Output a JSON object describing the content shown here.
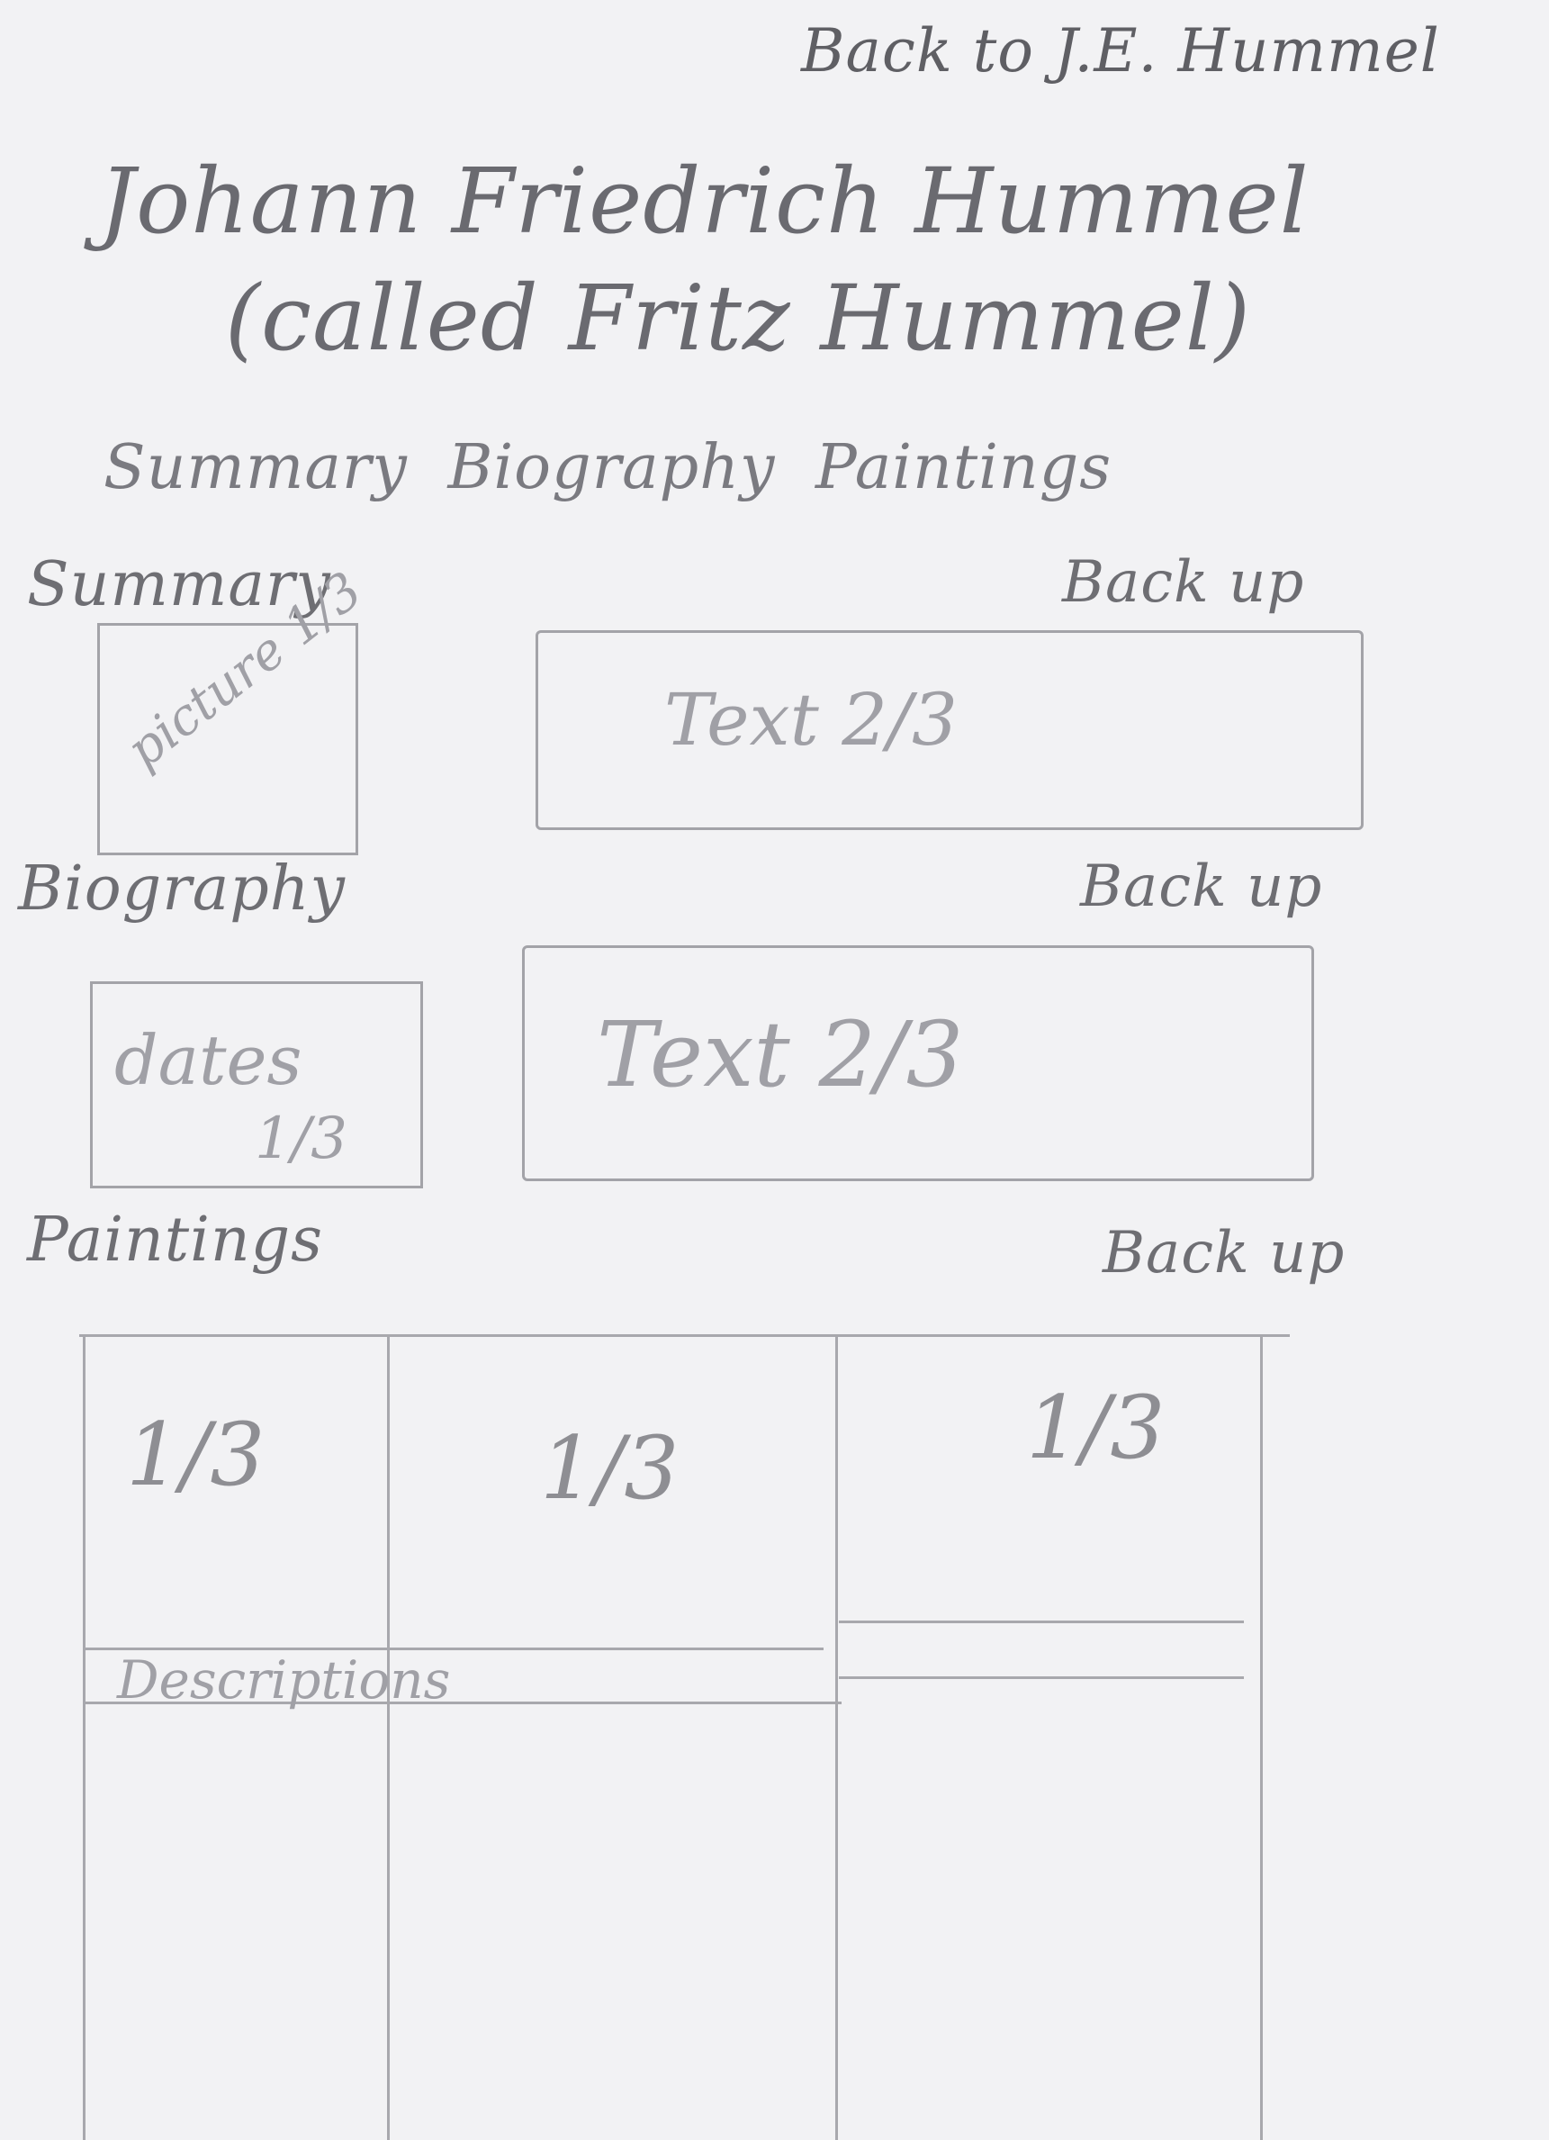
{
  "header": {
    "back_link": "Back to J.E. Hummel",
    "title_line1": "Johann Friedrich Hummel",
    "title_line2": "(called Fritz Hummel)"
  },
  "nav": {
    "items": [
      "Summary",
      "Biography",
      "Paintings"
    ]
  },
  "sections": {
    "summary": {
      "heading": "Summary",
      "back_up": "Back up",
      "picture_label": "picture 1/3",
      "text_label": "Text 2/3"
    },
    "biography": {
      "heading": "Biography",
      "back_up": "Back up",
      "dates_label": "dates",
      "dates_fraction": "1/3",
      "text_label": "Text 2/3"
    },
    "paintings": {
      "heading": "Paintings",
      "back_up": "Back up",
      "columns": [
        "1/3",
        "1/3",
        "1/3"
      ],
      "descriptions_label": "Descriptions"
    }
  }
}
